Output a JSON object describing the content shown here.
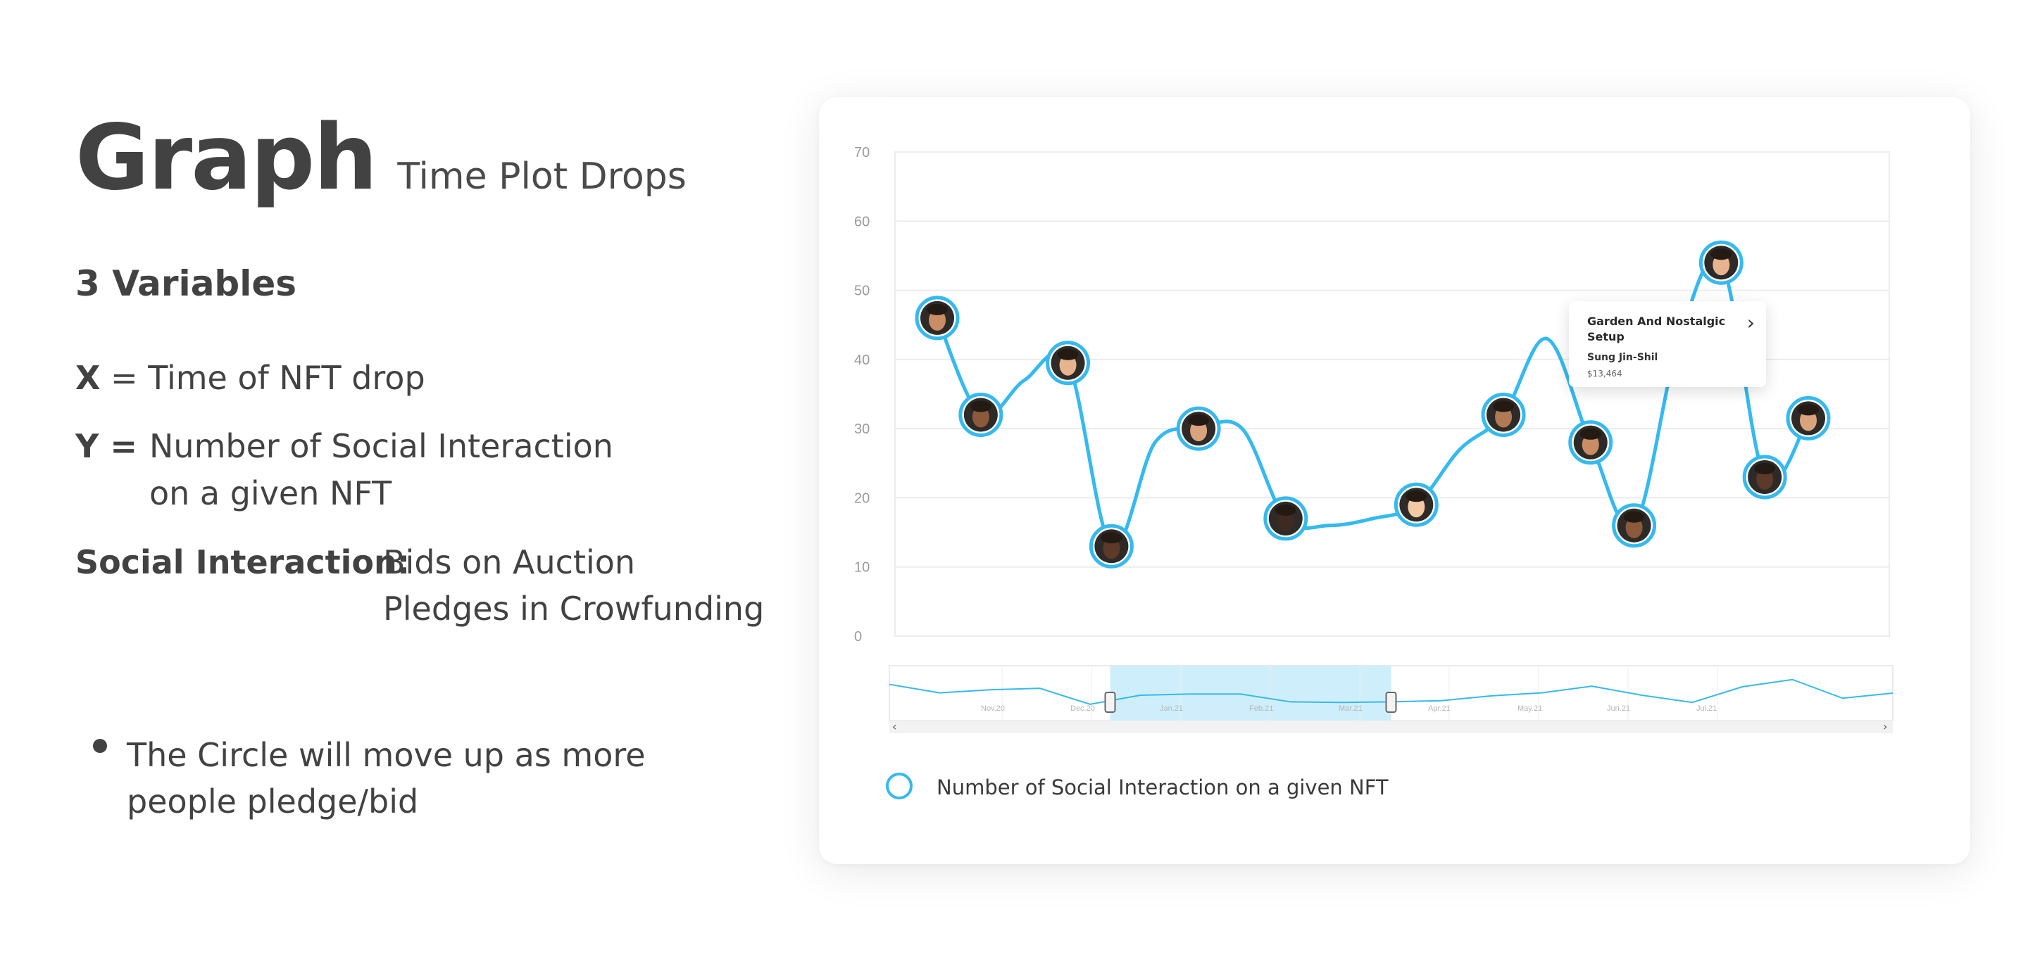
{
  "header": {
    "title": "Graph",
    "subtitle": "Time Plot Drops"
  },
  "variables": {
    "heading": "3 Variables",
    "x": {
      "key": "X",
      "eq": "= Time of NFT drop"
    },
    "y": {
      "key": "Y =",
      "line1": "Number of Social Interaction",
      "line2": "on a given NFT"
    },
    "social": {
      "key": "Social Interaction:",
      "line1": "Bids on Auction",
      "line2": "Pledges in Crowfunding"
    }
  },
  "note": {
    "line1": "The Circle will move up as more",
    "line2": "people pledge/bid"
  },
  "colors": {
    "series": "#35b9ef",
    "navigator_selection": "#cfeefb",
    "text": "#424242"
  },
  "chart_data": {
    "type": "line",
    "ylim": [
      0,
      70
    ],
    "yticks": [
      0,
      10,
      20,
      30,
      40,
      50,
      60,
      70
    ],
    "grid": true,
    "legend_position": "bottom-left",
    "series": [
      {
        "name": "Number of Social Interaction on a given NFT",
        "values": [
          46,
          32,
          37,
          39.5,
          13,
          28,
          30,
          30,
          17,
          16,
          17,
          19,
          27,
          32,
          43,
          28,
          16,
          42,
          54,
          23,
          31.5
        ]
      }
    ],
    "markers": [
      {
        "index": 0,
        "icon": "avatar-icon"
      },
      {
        "index": 1,
        "icon": "avatar-icon"
      },
      {
        "index": 3,
        "icon": "avatar-icon"
      },
      {
        "index": 4,
        "icon": "avatar-icon"
      },
      {
        "index": 6,
        "icon": "avatar-icon"
      },
      {
        "index": 8,
        "icon": "avatar-icon"
      },
      {
        "index": 11,
        "icon": "avatar-icon"
      },
      {
        "index": 13,
        "icon": "avatar-icon"
      },
      {
        "index": 15,
        "icon": "avatar-icon"
      },
      {
        "index": 16,
        "icon": "avatar-icon"
      },
      {
        "index": 18,
        "icon": "avatar-icon"
      },
      {
        "index": 19,
        "icon": "avatar-icon"
      },
      {
        "index": 20,
        "icon": "avatar-icon"
      }
    ],
    "tooltip": {
      "title": "Garden And Nostalgic Setup",
      "artist": "Sung Jin-Shil",
      "price": "$13,464"
    },
    "navigator": {
      "labels": [
        "Nov.20",
        "Dec.20",
        "Jan.21",
        "Feb.21",
        "Mar.21",
        "Apr.21",
        "May.21",
        "Jun.21",
        "Jul.21"
      ],
      "selection": [
        0.22,
        0.5
      ]
    }
  }
}
